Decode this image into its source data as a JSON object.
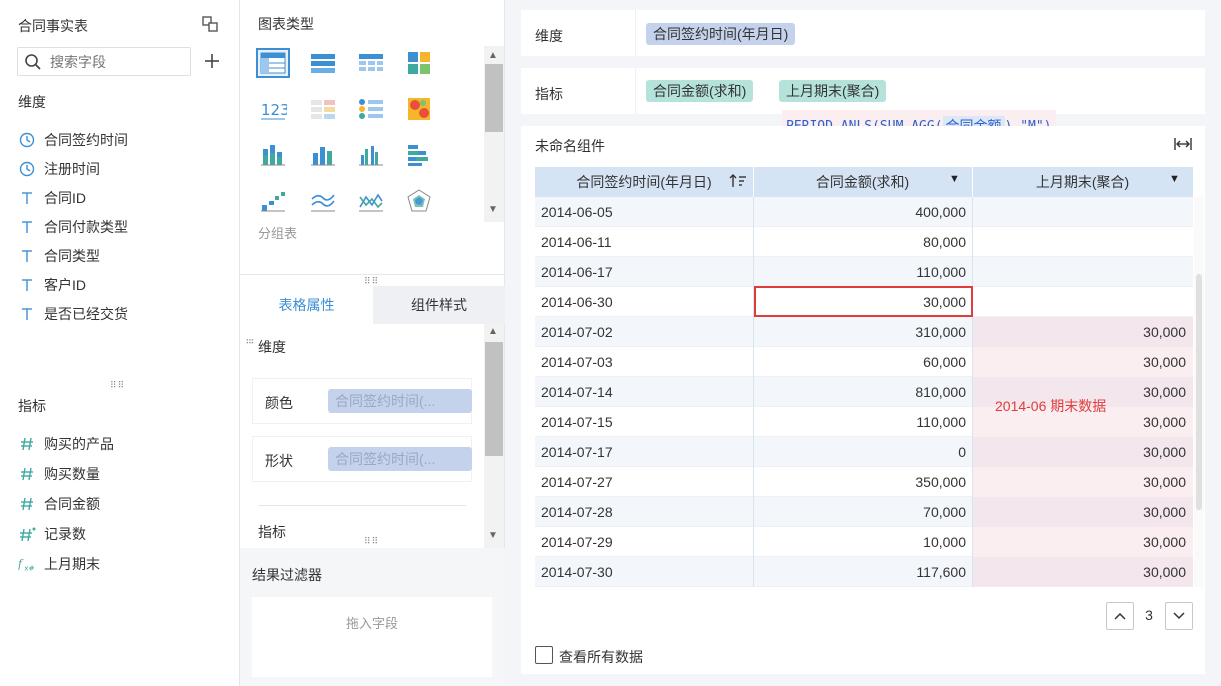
{
  "left": {
    "title": "合同事实表",
    "search_placeholder": "搜索字段",
    "dim_header": "维度",
    "dimensions": [
      {
        "label": "合同签约时间",
        "icon": "clock-icon"
      },
      {
        "label": "注册时间",
        "icon": "clock-icon"
      },
      {
        "label": "合同ID",
        "icon": "text-field-icon"
      },
      {
        "label": "合同付款类型",
        "icon": "text-field-icon"
      },
      {
        "label": "合同类型",
        "icon": "text-field-icon"
      },
      {
        "label": "客户ID",
        "icon": "text-field-icon"
      },
      {
        "label": "是否已经交货",
        "icon": "text-field-icon"
      }
    ],
    "metric_header": "指标",
    "metrics": [
      {
        "label": "购买的产品",
        "icon": "hash-icon"
      },
      {
        "label": "购买数量",
        "icon": "hash-icon"
      },
      {
        "label": "合同金额",
        "icon": "hash-icon"
      },
      {
        "label": "记录数",
        "icon": "record-count-icon"
      },
      {
        "label": "上月期末",
        "icon": "formula-icon"
      }
    ]
  },
  "middle": {
    "chart_type_header": "图表类型",
    "group_table_label": "分组表",
    "tabs": [
      "表格属性",
      "组件样式"
    ],
    "dim_section": "维度",
    "color_label": "颜色",
    "shape_label": "形状",
    "color_field": "合同签约时间(...",
    "shape_field": "合同签约时间(...",
    "metric_section": "指标",
    "filter_header": "结果过滤器",
    "drop_placeholder": "拖入字段"
  },
  "right": {
    "dimension_label": "维度",
    "dimension_pill": "合同签约时间(年月日)",
    "metric_label": "指标",
    "metric_pills": [
      "合同金额(求和)",
      "上月期末(聚合)"
    ],
    "formula": {
      "prefix": "PERIOD_ANLS(SUM_AGG(",
      "field": "合同金额",
      "suffix": "),\"M\")"
    },
    "component_title": "未命名组件",
    "columns": [
      "合同签约时间(年月日)",
      "合同金额(求和)",
      "上月期末(聚合)"
    ],
    "rows": [
      [
        "2014-06-05",
        "400,000",
        ""
      ],
      [
        "2014-06-11",
        "80,000",
        ""
      ],
      [
        "2014-06-17",
        "110,000",
        ""
      ],
      [
        "2014-06-30",
        "30,000",
        ""
      ],
      [
        "2014-07-02",
        "310,000",
        "30,000"
      ],
      [
        "2014-07-03",
        "60,000",
        "30,000"
      ],
      [
        "2014-07-14",
        "810,000",
        "30,000"
      ],
      [
        "2014-07-15",
        "110,000",
        "30,000"
      ],
      [
        "2014-07-17",
        "0",
        "30,000"
      ],
      [
        "2014-07-27",
        "350,000",
        "30,000"
      ],
      [
        "2014-07-28",
        "70,000",
        "30,000"
      ],
      [
        "2014-07-29",
        "10,000",
        "30,000"
      ],
      [
        "2014-07-30",
        "117,600",
        "30,000"
      ]
    ],
    "annotation": "2014-06 期末数据",
    "page_number": "3",
    "view_all_label": "查看所有数据",
    "colors": {
      "header_bg": "#d5e4f5",
      "pill_dim": "#c5d2ec",
      "pill_metric": "#b5e3dc",
      "highlight_border": "#e03c3c",
      "pink_row": "#fbeef1",
      "annotation_text": "#e03c3c"
    }
  }
}
